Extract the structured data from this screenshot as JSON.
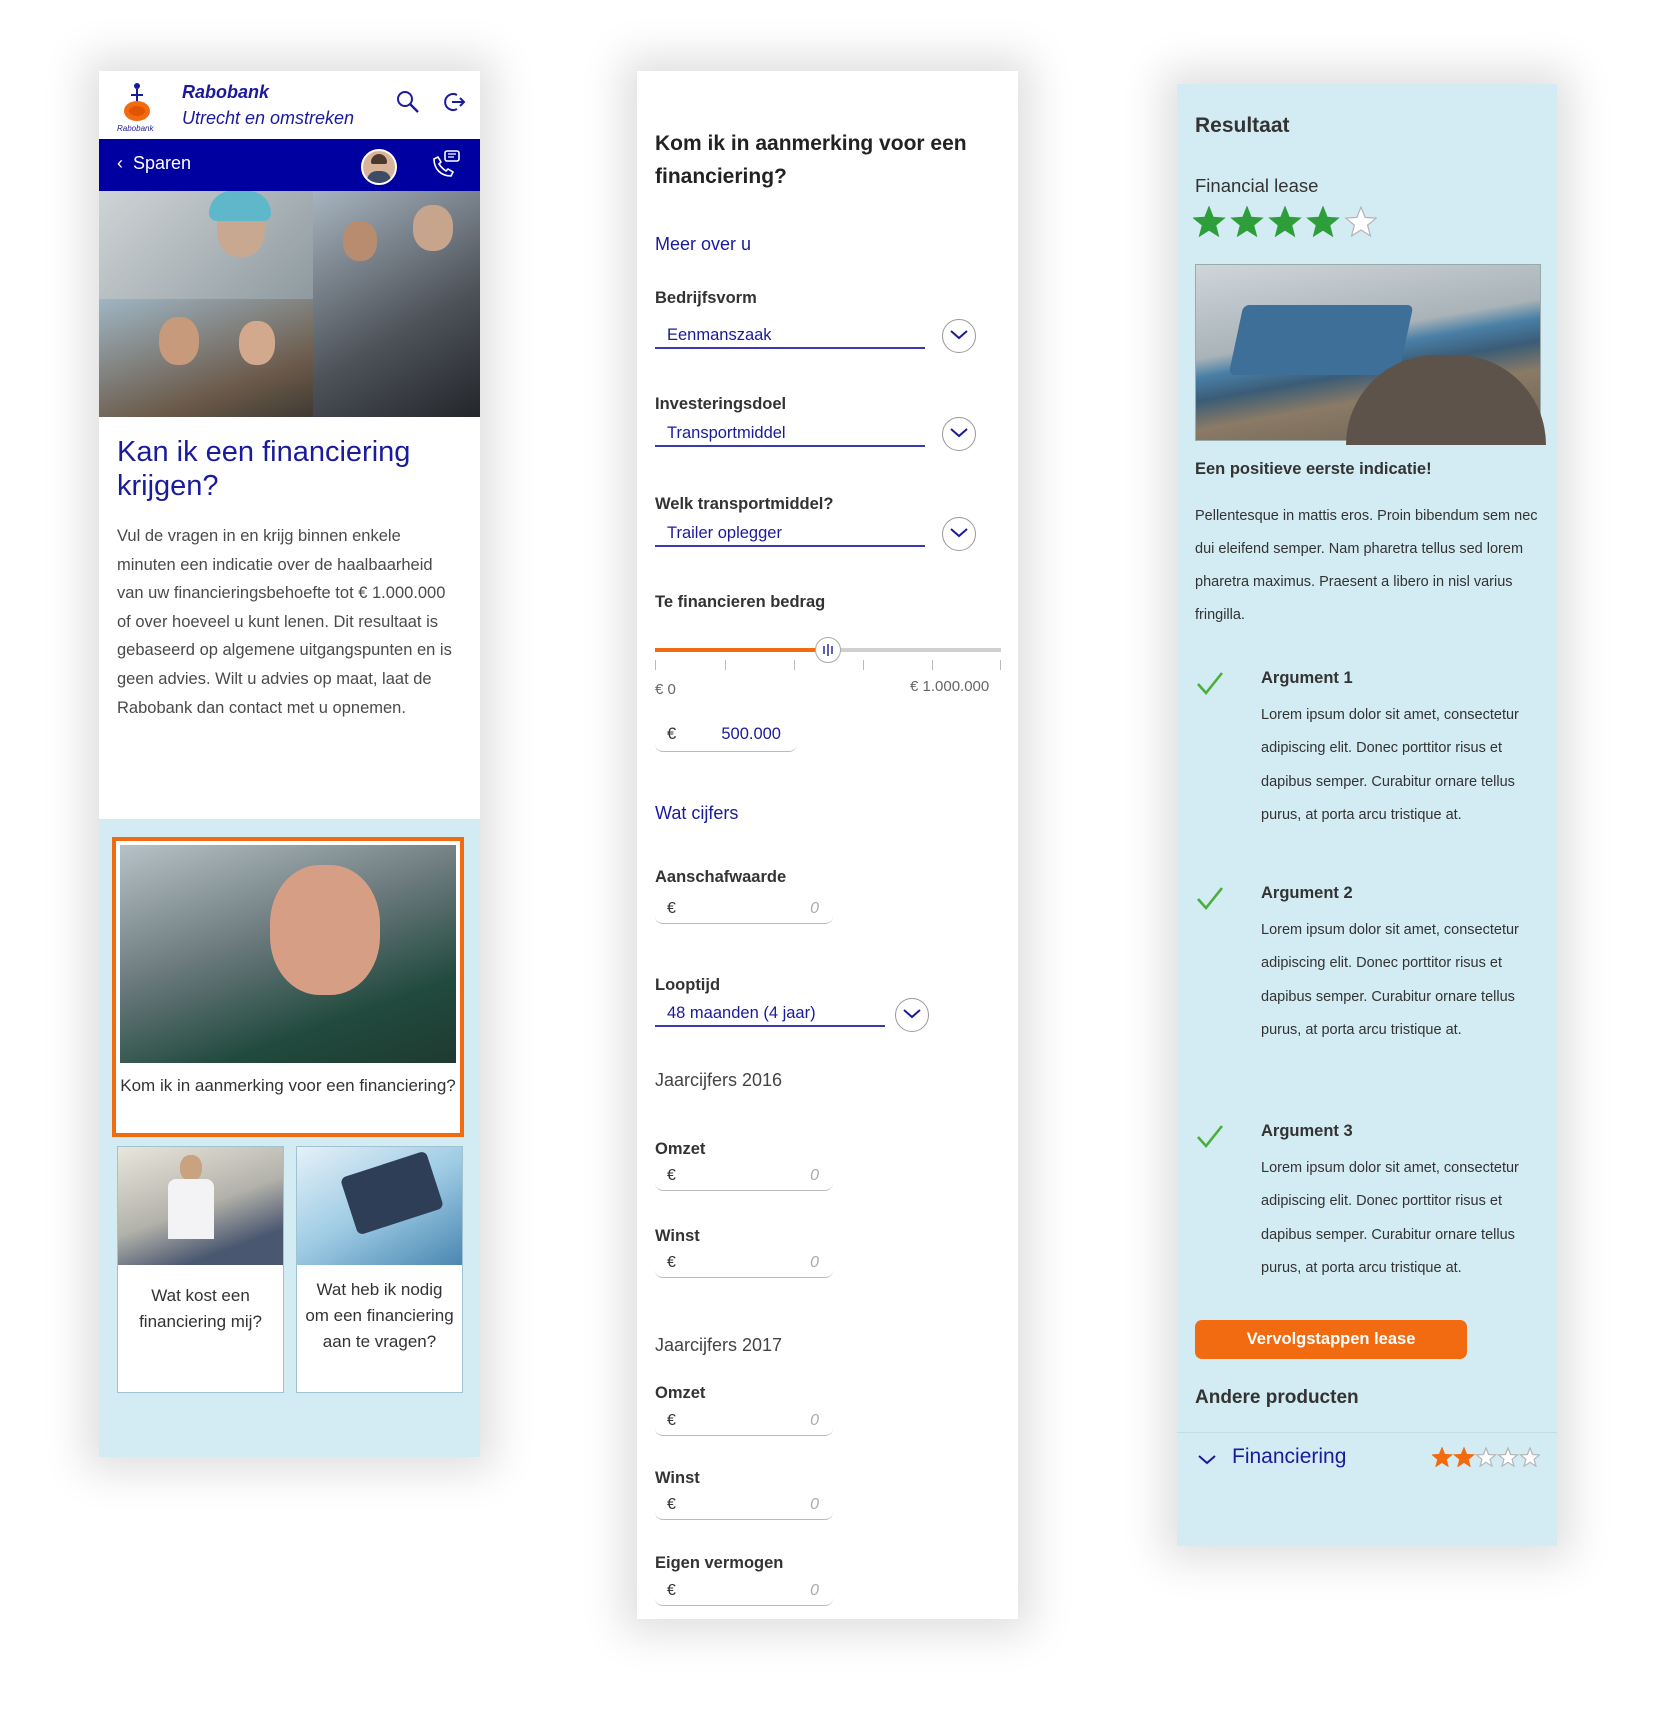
{
  "panel1": {
    "brand": {
      "line1": "Rabobank",
      "line2": "Utrecht en omstreken",
      "logo_text": "Rabobank"
    },
    "nav": {
      "back_label": "Sparen"
    },
    "icons": {
      "search": "search-icon",
      "logout": "logout-icon",
      "call": "phone-chat-icon",
      "back": "chevron-left-icon"
    },
    "title": "Kan ik een financiering krijgen?",
    "body": "Vul de vragen in en krijg binnen enkele minuten een indicatie over de haalbaarheid van uw financieringsbehoefte tot € 1.000.000 of over hoeveel u kunt lenen. Dit resultaat is gebaseerd op algemene uitgangspunten en is geen advies. Wilt u advies op maat, laat de Rabobank dan contact met u opnemen.",
    "card_main": "Kom ik in aanmerking voor een financiering?",
    "card_left": "Wat kost een financiering mij?",
    "card_right": "Wat heb ik nodig om een financiering aan te vragen?"
  },
  "panel2": {
    "title": "Kom ik in aanmerking voor een financiering?",
    "section_about": "Meer over u",
    "bedrijfsvorm": {
      "label": "Bedrijfsvorm",
      "value": "Eenmanszaak"
    },
    "investeringsdoel": {
      "label": "Investeringsdoel",
      "value": "Transportmiddel"
    },
    "transportmiddel": {
      "label": "Welk transportmiddel?",
      "value": "Trailer oplegger"
    },
    "bedrag": {
      "label": "Te financieren bedrag",
      "min_label": "€ 0",
      "max_label": "€ 1.000.000",
      "currency": "€",
      "value": "500.000",
      "fraction": 0.5
    },
    "section_figures": "Wat cijfers",
    "aanschafwaarde": {
      "label": "Aanschafwaarde",
      "currency": "€",
      "placeholder": "0"
    },
    "looptijd": {
      "label": "Looptijd",
      "value": "48 maanden (4 jaar)"
    },
    "jaar2016": {
      "heading": "Jaarcijfers 2016",
      "omzet": "Omzet",
      "winst": "Winst",
      "currency": "€",
      "placeholder": "0"
    },
    "jaar2017": {
      "heading": "Jaarcijfers 2017",
      "omzet": "Omzet",
      "winst": "Winst",
      "eigen": "Eigen vermogen",
      "currency": "€",
      "placeholder": "0"
    }
  },
  "panel3": {
    "title": "Resultaat",
    "product": "Financial lease",
    "rating": 4,
    "rating_max": 5,
    "headline": "Een positieve eerste indicatie!",
    "paragraph": "Pellentesque in mattis eros. Proin bibendum sem nec dui eleifend semper. Nam pharetra tellus sed lorem pharetra maximus. Praesent a libero in nisl varius fringilla.",
    "arguments": [
      {
        "title": "Argument 1",
        "body": "Lorem ipsum dolor sit amet, consectetur adipiscing elit. Donec porttitor risus et dapibus semper. Curabitur ornare tellus purus, at porta arcu tristique at."
      },
      {
        "title": "Argument 2",
        "body": "Lorem ipsum dolor sit amet, consectetur adipiscing elit. Donec porttitor risus et dapibus semper. Curabitur ornare tellus purus, at porta arcu tristique at."
      },
      {
        "title": "Argument 3",
        "body": "Lorem ipsum dolor sit amet, consectetur adipiscing elit. Donec porttitor risus et dapibus semper. Curabitur ornare tellus purus, at porta arcu tristique at."
      }
    ],
    "cta": "Vervolgstappen lease",
    "other_title": "Andere producten",
    "other_item": {
      "label": "Financiering",
      "rating": 2,
      "rating_max": 5
    }
  },
  "colors": {
    "brand_blue": "#0000a0",
    "accent_orange": "#f26b10",
    "star_green": "#2e9e3a",
    "check_green": "#4caf3a",
    "panel_bg": "#d3ebf3"
  }
}
